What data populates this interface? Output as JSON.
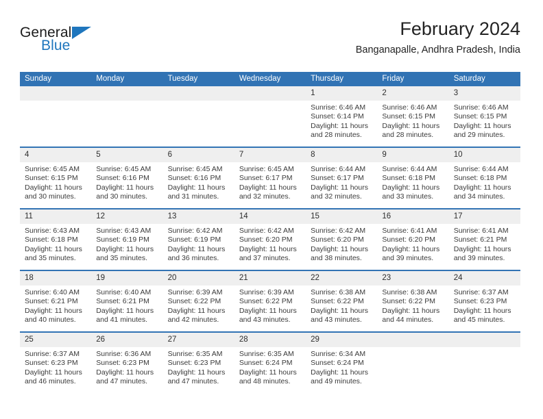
{
  "brand": {
    "name_top": "General",
    "name_bottom": "Blue",
    "triangle_color": "#1f76bd"
  },
  "header": {
    "title": "February 2024",
    "subtitle": "Banganapalle, Andhra Pradesh, India"
  },
  "theme": {
    "header_blue": "#3173b4",
    "daynum_gray": "#efefef",
    "text_dark": "#232323"
  },
  "weekday_headers": [
    "Sunday",
    "Monday",
    "Tuesday",
    "Wednesday",
    "Thursday",
    "Friday",
    "Saturday"
  ],
  "weeks": [
    [
      {
        "day": "",
        "empty": true,
        "sunrise": "",
        "sunset": "",
        "daylight_line1": "",
        "daylight_line2": ""
      },
      {
        "day": "",
        "empty": true,
        "sunrise": "",
        "sunset": "",
        "daylight_line1": "",
        "daylight_line2": ""
      },
      {
        "day": "",
        "empty": true,
        "sunrise": "",
        "sunset": "",
        "daylight_line1": "",
        "daylight_line2": ""
      },
      {
        "day": "",
        "empty": true,
        "sunrise": "",
        "sunset": "",
        "daylight_line1": "",
        "daylight_line2": ""
      },
      {
        "day": "1",
        "sunrise": "Sunrise: 6:46 AM",
        "sunset": "Sunset: 6:14 PM",
        "daylight_line1": "Daylight: 11 hours",
        "daylight_line2": "and 28 minutes."
      },
      {
        "day": "2",
        "sunrise": "Sunrise: 6:46 AM",
        "sunset": "Sunset: 6:15 PM",
        "daylight_line1": "Daylight: 11 hours",
        "daylight_line2": "and 28 minutes."
      },
      {
        "day": "3",
        "sunrise": "Sunrise: 6:46 AM",
        "sunset": "Sunset: 6:15 PM",
        "daylight_line1": "Daylight: 11 hours",
        "daylight_line2": "and 29 minutes."
      }
    ],
    [
      {
        "day": "4",
        "sunrise": "Sunrise: 6:45 AM",
        "sunset": "Sunset: 6:15 PM",
        "daylight_line1": "Daylight: 11 hours",
        "daylight_line2": "and 30 minutes."
      },
      {
        "day": "5",
        "sunrise": "Sunrise: 6:45 AM",
        "sunset": "Sunset: 6:16 PM",
        "daylight_line1": "Daylight: 11 hours",
        "daylight_line2": "and 30 minutes."
      },
      {
        "day": "6",
        "sunrise": "Sunrise: 6:45 AM",
        "sunset": "Sunset: 6:16 PM",
        "daylight_line1": "Daylight: 11 hours",
        "daylight_line2": "and 31 minutes."
      },
      {
        "day": "7",
        "sunrise": "Sunrise: 6:45 AM",
        "sunset": "Sunset: 6:17 PM",
        "daylight_line1": "Daylight: 11 hours",
        "daylight_line2": "and 32 minutes."
      },
      {
        "day": "8",
        "sunrise": "Sunrise: 6:44 AM",
        "sunset": "Sunset: 6:17 PM",
        "daylight_line1": "Daylight: 11 hours",
        "daylight_line2": "and 32 minutes."
      },
      {
        "day": "9",
        "sunrise": "Sunrise: 6:44 AM",
        "sunset": "Sunset: 6:18 PM",
        "daylight_line1": "Daylight: 11 hours",
        "daylight_line2": "and 33 minutes."
      },
      {
        "day": "10",
        "sunrise": "Sunrise: 6:44 AM",
        "sunset": "Sunset: 6:18 PM",
        "daylight_line1": "Daylight: 11 hours",
        "daylight_line2": "and 34 minutes."
      }
    ],
    [
      {
        "day": "11",
        "sunrise": "Sunrise: 6:43 AM",
        "sunset": "Sunset: 6:18 PM",
        "daylight_line1": "Daylight: 11 hours",
        "daylight_line2": "and 35 minutes."
      },
      {
        "day": "12",
        "sunrise": "Sunrise: 6:43 AM",
        "sunset": "Sunset: 6:19 PM",
        "daylight_line1": "Daylight: 11 hours",
        "daylight_line2": "and 35 minutes."
      },
      {
        "day": "13",
        "sunrise": "Sunrise: 6:42 AM",
        "sunset": "Sunset: 6:19 PM",
        "daylight_line1": "Daylight: 11 hours",
        "daylight_line2": "and 36 minutes."
      },
      {
        "day": "14",
        "sunrise": "Sunrise: 6:42 AM",
        "sunset": "Sunset: 6:20 PM",
        "daylight_line1": "Daylight: 11 hours",
        "daylight_line2": "and 37 minutes."
      },
      {
        "day": "15",
        "sunrise": "Sunrise: 6:42 AM",
        "sunset": "Sunset: 6:20 PM",
        "daylight_line1": "Daylight: 11 hours",
        "daylight_line2": "and 38 minutes."
      },
      {
        "day": "16",
        "sunrise": "Sunrise: 6:41 AM",
        "sunset": "Sunset: 6:20 PM",
        "daylight_line1": "Daylight: 11 hours",
        "daylight_line2": "and 39 minutes."
      },
      {
        "day": "17",
        "sunrise": "Sunrise: 6:41 AM",
        "sunset": "Sunset: 6:21 PM",
        "daylight_line1": "Daylight: 11 hours",
        "daylight_line2": "and 39 minutes."
      }
    ],
    [
      {
        "day": "18",
        "sunrise": "Sunrise: 6:40 AM",
        "sunset": "Sunset: 6:21 PM",
        "daylight_line1": "Daylight: 11 hours",
        "daylight_line2": "and 40 minutes."
      },
      {
        "day": "19",
        "sunrise": "Sunrise: 6:40 AM",
        "sunset": "Sunset: 6:21 PM",
        "daylight_line1": "Daylight: 11 hours",
        "daylight_line2": "and 41 minutes."
      },
      {
        "day": "20",
        "sunrise": "Sunrise: 6:39 AM",
        "sunset": "Sunset: 6:22 PM",
        "daylight_line1": "Daylight: 11 hours",
        "daylight_line2": "and 42 minutes."
      },
      {
        "day": "21",
        "sunrise": "Sunrise: 6:39 AM",
        "sunset": "Sunset: 6:22 PM",
        "daylight_line1": "Daylight: 11 hours",
        "daylight_line2": "and 43 minutes."
      },
      {
        "day": "22",
        "sunrise": "Sunrise: 6:38 AM",
        "sunset": "Sunset: 6:22 PM",
        "daylight_line1": "Daylight: 11 hours",
        "daylight_line2": "and 43 minutes."
      },
      {
        "day": "23",
        "sunrise": "Sunrise: 6:38 AM",
        "sunset": "Sunset: 6:22 PM",
        "daylight_line1": "Daylight: 11 hours",
        "daylight_line2": "and 44 minutes."
      },
      {
        "day": "24",
        "sunrise": "Sunrise: 6:37 AM",
        "sunset": "Sunset: 6:23 PM",
        "daylight_line1": "Daylight: 11 hours",
        "daylight_line2": "and 45 minutes."
      }
    ],
    [
      {
        "day": "25",
        "sunrise": "Sunrise: 6:37 AM",
        "sunset": "Sunset: 6:23 PM",
        "daylight_line1": "Daylight: 11 hours",
        "daylight_line2": "and 46 minutes."
      },
      {
        "day": "26",
        "sunrise": "Sunrise: 6:36 AM",
        "sunset": "Sunset: 6:23 PM",
        "daylight_line1": "Daylight: 11 hours",
        "daylight_line2": "and 47 minutes."
      },
      {
        "day": "27",
        "sunrise": "Sunrise: 6:35 AM",
        "sunset": "Sunset: 6:23 PM",
        "daylight_line1": "Daylight: 11 hours",
        "daylight_line2": "and 47 minutes."
      },
      {
        "day": "28",
        "sunrise": "Sunrise: 6:35 AM",
        "sunset": "Sunset: 6:24 PM",
        "daylight_line1": "Daylight: 11 hours",
        "daylight_line2": "and 48 minutes."
      },
      {
        "day": "29",
        "sunrise": "Sunrise: 6:34 AM",
        "sunset": "Sunset: 6:24 PM",
        "daylight_line1": "Daylight: 11 hours",
        "daylight_line2": "and 49 minutes."
      },
      {
        "day": "",
        "empty": true,
        "sunrise": "",
        "sunset": "",
        "daylight_line1": "",
        "daylight_line2": ""
      },
      {
        "day": "",
        "empty": true,
        "sunrise": "",
        "sunset": "",
        "daylight_line1": "",
        "daylight_line2": ""
      }
    ]
  ]
}
